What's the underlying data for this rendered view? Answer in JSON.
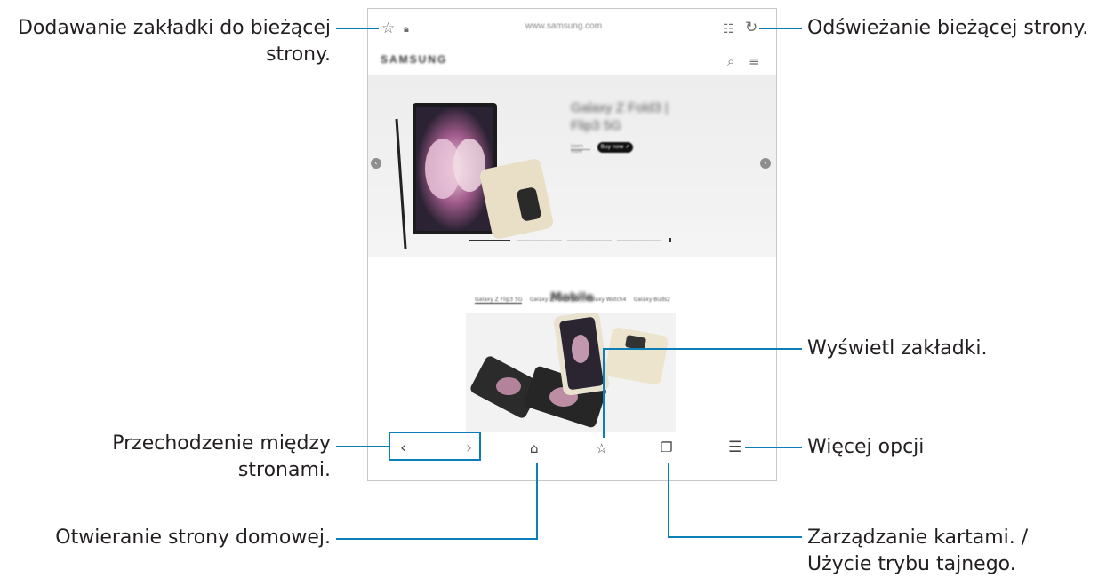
{
  "browser": {
    "url": "www.samsung.com",
    "site_logo": "SAMSUNG",
    "hero": {
      "title": "Galaxy Z Fold3 | Flip3 5G",
      "learn_more": "Learn more",
      "buy_now": "Buy now ↗"
    },
    "mobile_section": {
      "title": "Mobile",
      "tabs": [
        "Galaxy Z Flip3 5G",
        "Galaxy Z Fold3 5G",
        "Galaxy Watch4",
        "Galaxy Buds2"
      ]
    }
  },
  "callouts": {
    "bookmark_add": [
      "Dodawanie zakładki do bieżącej",
      "strony."
    ],
    "refresh": "Odświeżanie bieżącej strony.",
    "view_bookmarks": "Wyświetl zakładki.",
    "navigate": [
      "Przechodzenie między",
      "stronami."
    ],
    "more_options": "Więcej opcji",
    "home": "Otwieranie strony domowej.",
    "tabs": [
      "Zarządzanie kartami. /",
      "Użycie trybu tajnego."
    ]
  },
  "colors": {
    "accent_line": "#0d7fb8",
    "text": "#231f20",
    "frame": "#c8c8c8"
  },
  "icons": [
    "star-icon",
    "lock-icon",
    "reader-mode-icon",
    "refresh-icon",
    "search-icon",
    "menu-icon",
    "back-icon",
    "forward-icon",
    "home-icon",
    "bookmarks-icon",
    "tabs-icon",
    "more-options-icon"
  ]
}
